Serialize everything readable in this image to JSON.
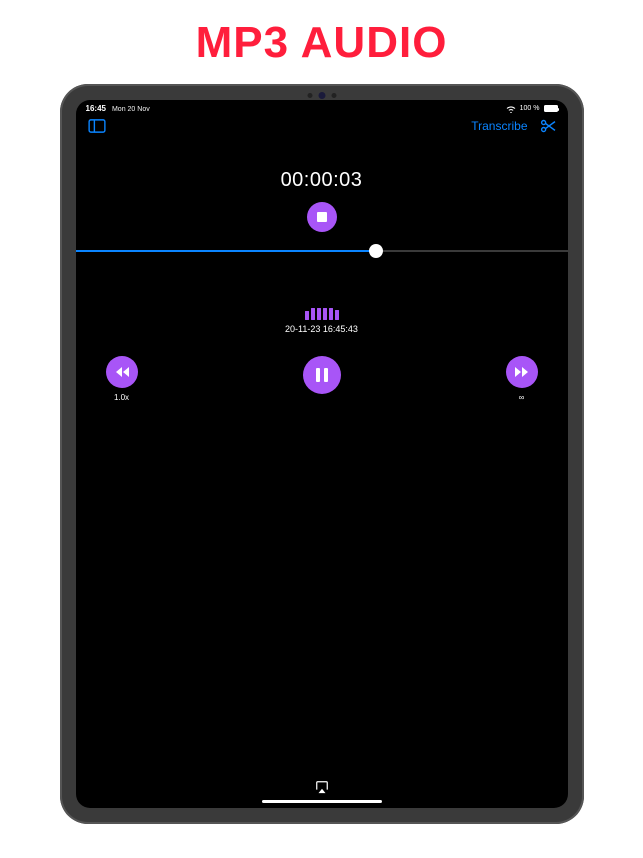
{
  "headline": "MP3 AUDIO",
  "status": {
    "time": "16:45",
    "date": "Mon 20 Nov",
    "battery": "100 %"
  },
  "nav": {
    "transcribe": "Transcribe"
  },
  "player": {
    "timer": "00:00:03",
    "track_title": "20-11-23 16:45:43",
    "seek_percent": 61
  },
  "controls": {
    "speed_label": "1.0x",
    "loop_label": "∞"
  },
  "colors": {
    "accent_purple": "#a855f7",
    "accent_blue": "#0a84ff",
    "headline_red": "#ff1e3c"
  }
}
